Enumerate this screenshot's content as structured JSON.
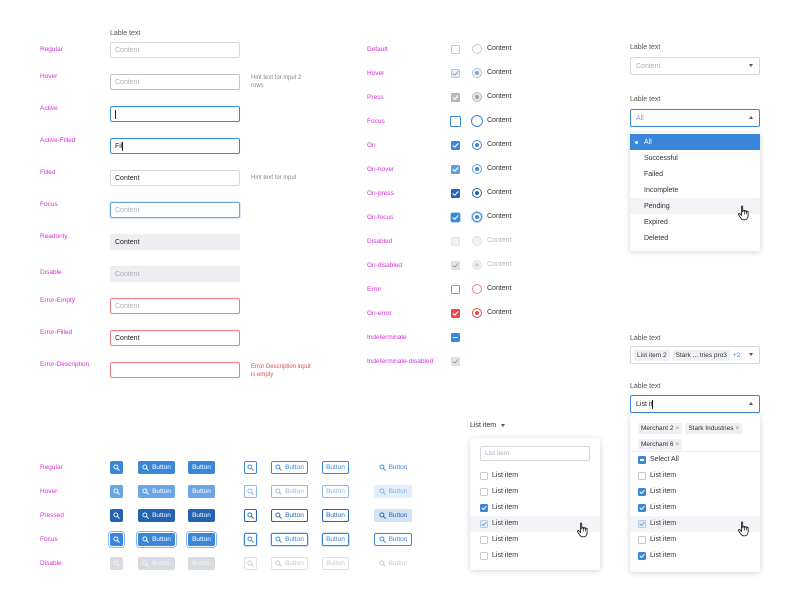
{
  "text_inputs": {
    "label": "Lable text",
    "states": [
      {
        "label": "Regular",
        "placeholder": "Content",
        "value": "",
        "hint": ""
      },
      {
        "label": "Hover",
        "placeholder": "Content",
        "value": "",
        "hint": "Hint text for input 2 rows"
      },
      {
        "label": "Active",
        "placeholder": "",
        "value": "",
        "hint": ""
      },
      {
        "label": "Active-Filled",
        "placeholder": "",
        "value": "Fil",
        "hint": ""
      },
      {
        "label": "Filled",
        "placeholder": "",
        "value": "Content",
        "hint": "Hint text for input"
      },
      {
        "label": "Focus",
        "placeholder": "Content",
        "value": "",
        "hint": ""
      },
      {
        "label": "Readonly",
        "placeholder": "",
        "value": "Content",
        "hint": ""
      },
      {
        "label": "Disable",
        "placeholder": "Content",
        "value": "",
        "hint": ""
      },
      {
        "label": "Error-Empty",
        "placeholder": "Content",
        "value": "",
        "hint": ""
      },
      {
        "label": "Error-Filled",
        "placeholder": "",
        "value": "Content",
        "hint": ""
      },
      {
        "label": "Error-Description",
        "placeholder": "",
        "value": "",
        "hint": "Error Description input is empty"
      }
    ]
  },
  "checkbox_states": [
    {
      "label": "Default",
      "content": "Content"
    },
    {
      "label": "Hover",
      "content": "Content"
    },
    {
      "label": "Press",
      "content": "Content"
    },
    {
      "label": "Focus",
      "content": "Content"
    },
    {
      "label": "On",
      "content": "Content"
    },
    {
      "label": "On-hover",
      "content": "Content"
    },
    {
      "label": "On-press",
      "content": "Content"
    },
    {
      "label": "On-focus",
      "content": "Content"
    },
    {
      "label": "Disabled",
      "content": "Content"
    },
    {
      "label": "On-disabled",
      "content": "Content"
    },
    {
      "label": "Error",
      "content": "Content"
    },
    {
      "label": "On-error",
      "content": "Content"
    },
    {
      "label": "Indeterminate",
      "content": ""
    },
    {
      "label": "Indeterminate-disabled",
      "content": ""
    }
  ],
  "select_closed": {
    "label": "Lable text",
    "placeholder": "Content"
  },
  "select_open": {
    "label": "Lable text",
    "value": "All",
    "options": [
      "All",
      "Successful",
      "Failed",
      "Incomplete",
      "Pending",
      "Expired",
      "Deleted"
    ]
  },
  "multiselect_closed": {
    "label": "Lable text",
    "chips": [
      "List item 2",
      "Stark ... tries pro3"
    ],
    "more": "+2"
  },
  "multiselect_open": {
    "label": "Lable text",
    "search_value": "List it",
    "chips": [
      "Merchant 2",
      "Stark Industries",
      "Merchant 6"
    ],
    "select_all": "Select All",
    "items": [
      "List item",
      "List item",
      "List item",
      "List item",
      "List item",
      "List item"
    ]
  },
  "list_dropdown": {
    "trigger": "List item",
    "search_placeholder": "List item",
    "items": [
      "List item",
      "List item",
      "List item",
      "List item",
      "List item",
      "List item"
    ]
  },
  "buttons": {
    "label": "Button",
    "states": [
      "Regular",
      "Hover",
      "Pressed",
      "Focus",
      "Disable"
    ]
  },
  "colors": {
    "primary": "#3a86d8",
    "state_label": "#d62fd6",
    "error": "#e5484d"
  },
  "icons": {
    "search": "magnifier-icon",
    "check": "checkmark-icon",
    "cursor": "hand-pointer-icon"
  }
}
